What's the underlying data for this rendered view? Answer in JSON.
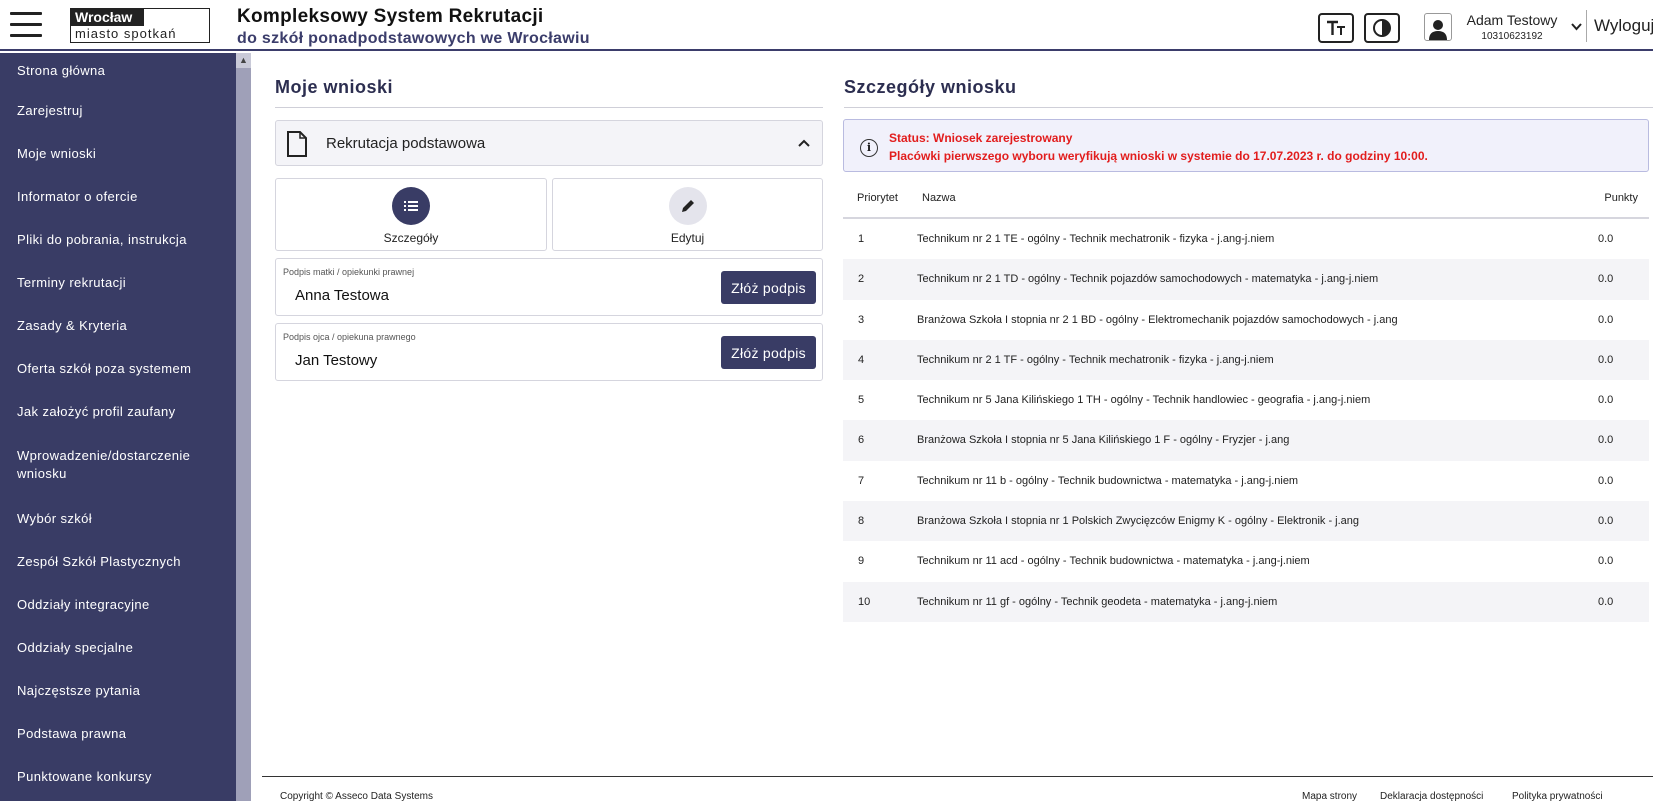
{
  "header": {
    "logo_top": "Wrocław",
    "logo_bottom": "miasto spotkań",
    "title": "Kompleksowy System Rekrutacji",
    "subtitle": "do szkół ponadpodstawowych we Wrocławiu",
    "font_size_icon": "font-size-icon",
    "contrast_icon": "contrast-icon",
    "user_name": "Adam Testowy",
    "user_id": "10310623192",
    "logout": "Wyloguj"
  },
  "sidebar": {
    "items": [
      {
        "label": "Strona główna"
      },
      {
        "label": "Zarejestruj"
      },
      {
        "label": "Moje wnioski"
      },
      {
        "label": "Informator o ofercie"
      },
      {
        "label": "Pliki do pobrania, instrukcja"
      },
      {
        "label": "Terminy rekrutacji"
      },
      {
        "label": "Zasady & Kryteria"
      },
      {
        "label": "Oferta szkół poza systemem"
      },
      {
        "label": "Jak założyć profil zaufany"
      },
      {
        "label": "Wprowadzenie/dostarczenie wniosku"
      },
      {
        "label": "Wybór szkół"
      },
      {
        "label": "Zespół Szkół Plastycznych"
      },
      {
        "label": "Oddziały integracyjne"
      },
      {
        "label": "Oddziały specjalne"
      },
      {
        "label": "Najczęstsze pytania"
      },
      {
        "label": "Podstawa prawna"
      },
      {
        "label": "Punktowane konkursy"
      }
    ]
  },
  "left": {
    "title": "Moje wnioski",
    "accordion_label": "Rekrutacja podstawowa",
    "details_label": "Szczegóły",
    "edit_label": "Edytuj",
    "mother_caption": "Podpis matki / opiekunki prawnej",
    "mother_name": "Anna Testowa",
    "father_caption": "Podpis ojca / opiekuna prawnego",
    "father_name": "Jan Testowy",
    "sign_label": "Złóż podpis"
  },
  "right": {
    "title": "Szczegóły wniosku",
    "status_line1": "Status: Wniosek zarejestrowany",
    "status_line2": "Placówki pierwszego wyboru weryfikują wnioski w systemie do 17.07.2023 r. do godziny 10:00.",
    "columns": {
      "priority": "Priorytet",
      "name": "Nazwa",
      "points": "Punkty"
    },
    "rows": [
      {
        "priority": "1",
        "name": "Technikum nr 2 1 TE - ogólny - Technik mechatronik - fizyka - j.ang-j.niem",
        "points": "0.0"
      },
      {
        "priority": "2",
        "name": "Technikum nr 2 1 TD - ogólny - Technik pojazdów samochodowych - matematyka - j.ang-j.niem",
        "points": "0.0"
      },
      {
        "priority": "3",
        "name": "Branżowa Szkoła I stopnia nr 2 1 BD - ogólny - Elektromechanik pojazdów samochodowych - j.ang",
        "points": "0.0"
      },
      {
        "priority": "4",
        "name": "Technikum nr 2 1 TF - ogólny - Technik mechatronik - fizyka - j.ang-j.niem",
        "points": "0.0"
      },
      {
        "priority": "5",
        "name": "Technikum nr 5 Jana Kilińskiego 1 TH - ogólny - Technik handlowiec - geografia - j.ang-j.niem",
        "points": "0.0"
      },
      {
        "priority": "6",
        "name": "Branżowa Szkoła I stopnia nr 5 Jana Kilińskiego 1 F - ogólny - Fryzjer - j.ang",
        "points": "0.0"
      },
      {
        "priority": "7",
        "name": "Technikum nr 11 b - ogólny - Technik budownictwa - matematyka - j.ang-j.niem",
        "points": "0.0"
      },
      {
        "priority": "8",
        "name": "Branżowa Szkoła I stopnia nr 1 Polskich Zwycięzców Enigmy K - ogólny - Elektronik - j.ang",
        "points": "0.0"
      },
      {
        "priority": "9",
        "name": "Technikum nr 11 acd - ogólny - Technik budownictwa - matematyka - j.ang-j.niem",
        "points": "0.0"
      },
      {
        "priority": "10",
        "name": "Technikum nr 11 gf - ogólny - Technik geodeta - matematyka - j.ang-j.niem",
        "points": "0.0"
      }
    ]
  },
  "footer": {
    "copyright": "Copyright © Asseco Data Systems",
    "link1": "Mapa strony",
    "link2": "Deklaracja dostępności",
    "link3": "Polityka prywatności"
  },
  "colors": {
    "sidebar_bg": "#393c65",
    "accent": "#393c65",
    "status_text": "#e21d1d",
    "status_bg": "#f1f1fb"
  }
}
